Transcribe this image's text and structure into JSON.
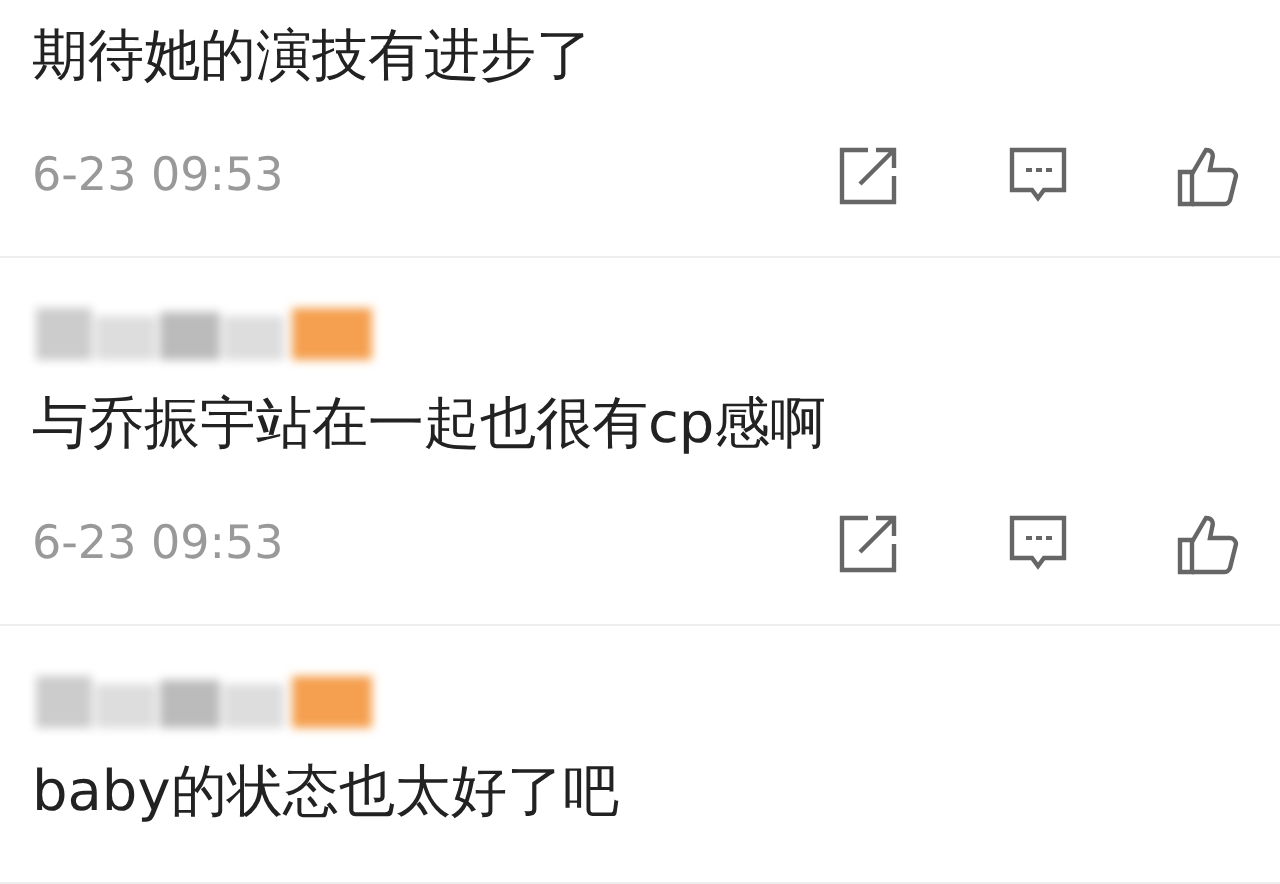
{
  "comments": [
    {
      "author_blurred": false,
      "text": "期待她的演技有进步了",
      "time": "6-23 09:53"
    },
    {
      "author_blurred": true,
      "text": "与乔振宇站在一起也很有cp感啊",
      "time": "6-23 09:53"
    },
    {
      "author_blurred": true,
      "text": "baby的状态也太好了吧"
    }
  ]
}
